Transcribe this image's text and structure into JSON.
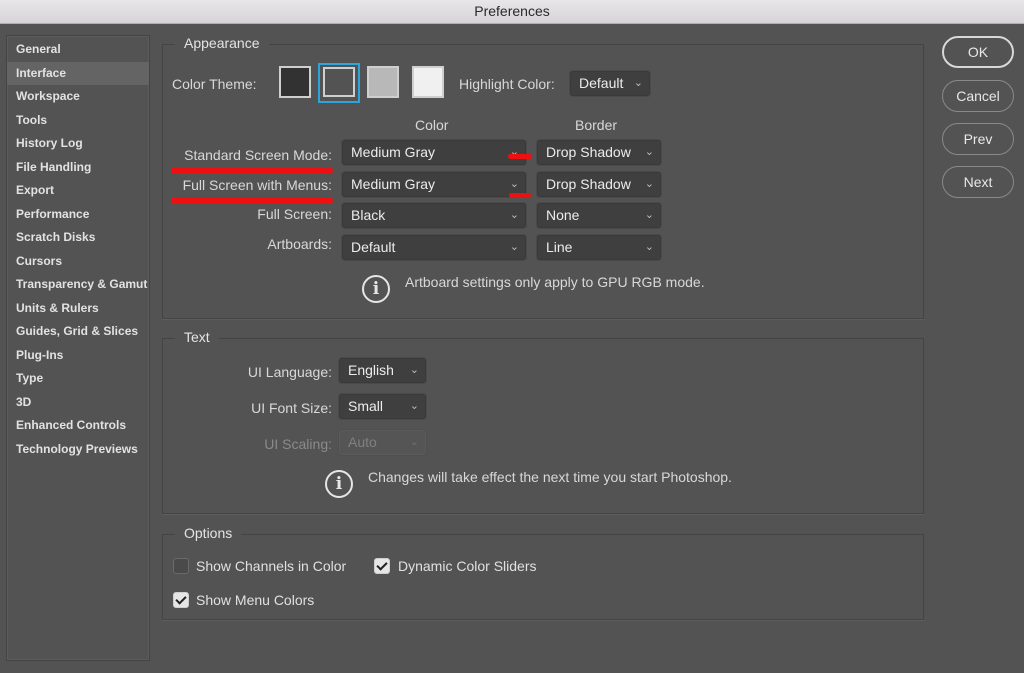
{
  "window": {
    "title": "Preferences"
  },
  "sidebar": {
    "active": "Interface",
    "items": [
      {
        "label": "General"
      },
      {
        "label": "Interface"
      },
      {
        "label": "Workspace"
      },
      {
        "label": "Tools"
      },
      {
        "label": "History Log"
      },
      {
        "label": "File Handling"
      },
      {
        "label": "Export"
      },
      {
        "label": "Performance"
      },
      {
        "label": "Scratch Disks"
      },
      {
        "label": "Cursors"
      },
      {
        "label": "Transparency & Gamut"
      },
      {
        "label": "Units & Rulers"
      },
      {
        "label": "Guides, Grid & Slices"
      },
      {
        "label": "Plug-Ins"
      },
      {
        "label": "Type"
      },
      {
        "label": "3D"
      },
      {
        "label": "Enhanced Controls"
      },
      {
        "label": "Technology Previews"
      }
    ]
  },
  "appearance": {
    "title": "Appearance",
    "color_theme_label": "Color Theme:",
    "themes": [
      {
        "name": "darkest",
        "color": "#323232"
      },
      {
        "name": "dark",
        "color": "#535353",
        "selected": true
      },
      {
        "name": "medium-light",
        "color": "#b8b8b8"
      },
      {
        "name": "lightest",
        "color": "#f0f0f0"
      }
    ],
    "selection_color": "#2ca6d8",
    "highlight_label": "Highlight Color:",
    "highlight_value": "Default",
    "col_color": "Color",
    "col_border": "Border",
    "rows": [
      {
        "label": "Standard Screen Mode:",
        "color": "Medium Gray",
        "border": "Drop Shadow"
      },
      {
        "label": "Full Screen with Menus:",
        "color": "Medium Gray",
        "border": "Drop Shadow"
      },
      {
        "label": "Full Screen:",
        "color": "Black",
        "border": "None"
      },
      {
        "label": "Artboards:",
        "color": "Default",
        "border": "Line"
      }
    ],
    "note": "Artboard settings only apply to GPU RGB mode."
  },
  "text": {
    "title": "Text",
    "language_label": "UI Language:",
    "language_value": "English",
    "font_size_label": "UI Font Size:",
    "font_size_value": "Small",
    "scaling_label": "UI Scaling:",
    "scaling_value": "Auto",
    "note": "Changes will take effect the next time you start Photoshop."
  },
  "options": {
    "title": "Options",
    "show_channels_label": "Show Channels in Color",
    "show_channels_checked": false,
    "dynamic_sliders_label": "Dynamic Color Sliders",
    "dynamic_sliders_checked": true,
    "show_menu_colors_label": "Show Menu Colors",
    "show_menu_colors_checked": true
  },
  "buttons": {
    "ok": "OK",
    "cancel": "Cancel",
    "prev": "Prev",
    "next": "Next"
  },
  "icons": {
    "chevron": "⌄",
    "info": "i"
  },
  "annotation": {
    "color": "#ee1010"
  }
}
